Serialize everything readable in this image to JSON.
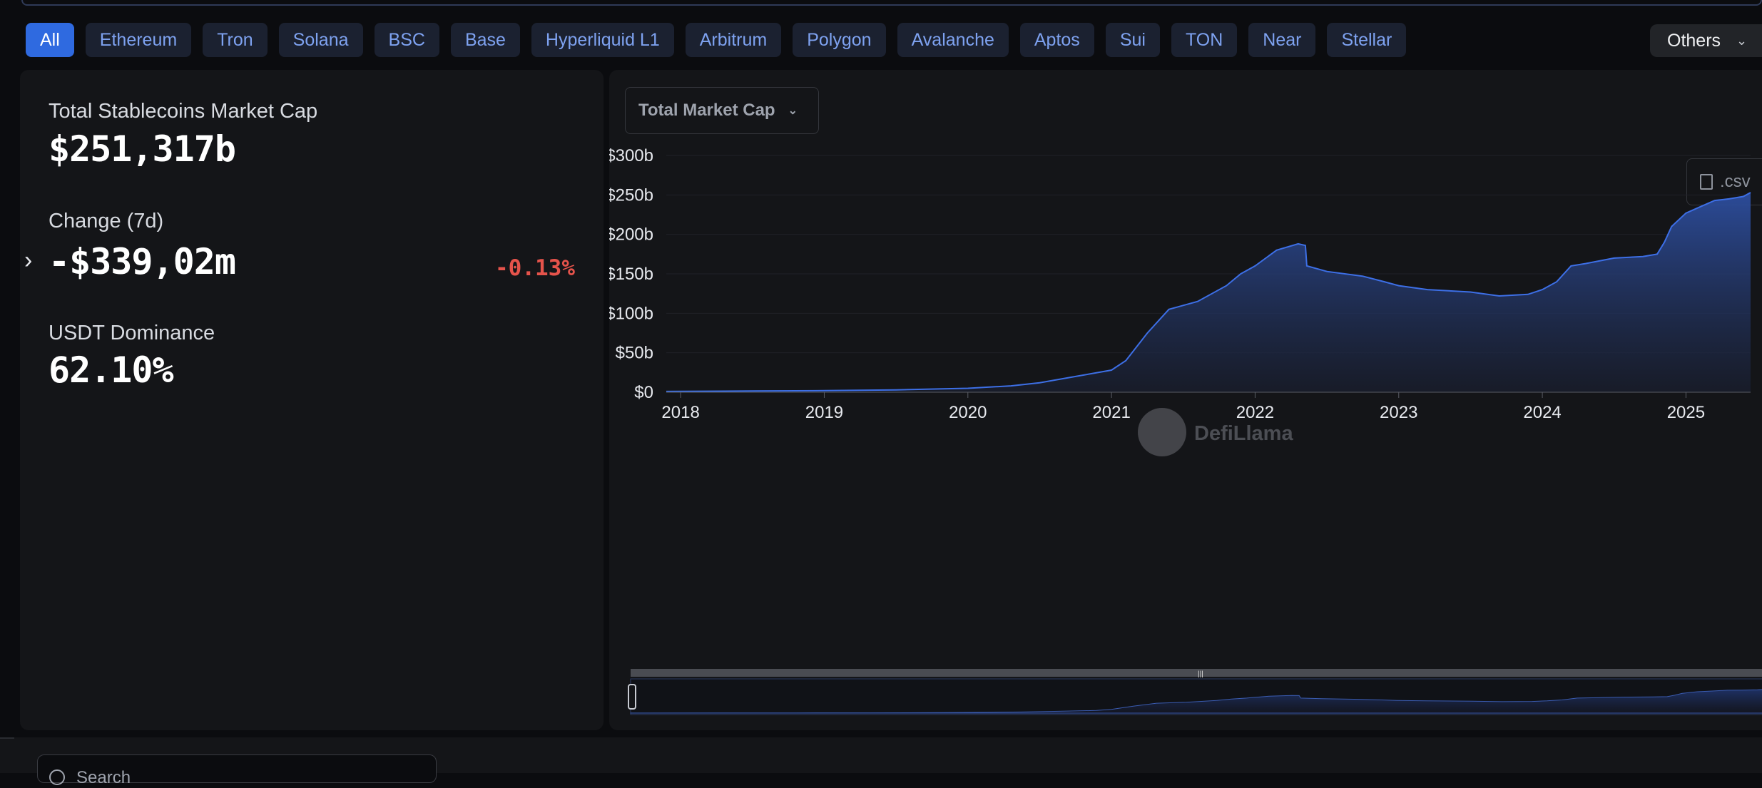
{
  "tabs": [
    {
      "label": "All",
      "active": true
    },
    {
      "label": "Ethereum"
    },
    {
      "label": "Tron"
    },
    {
      "label": "Solana"
    },
    {
      "label": "BSC"
    },
    {
      "label": "Base"
    },
    {
      "label": "Hyperliquid L1"
    },
    {
      "label": "Arbitrum"
    },
    {
      "label": "Polygon"
    },
    {
      "label": "Avalanche"
    },
    {
      "label": "Aptos"
    },
    {
      "label": "Sui"
    },
    {
      "label": "TON"
    },
    {
      "label": "Near"
    },
    {
      "label": "Stellar"
    }
  ],
  "others": {
    "label": "Others",
    "icon": "chevron-down-icon"
  },
  "stats": {
    "total_label": "Total Stablecoins Market Cap",
    "total_value": "$251,317b",
    "change_label": "Change (7d)",
    "change_value": "-$339,02m",
    "change_pct": "-0.13%",
    "dominance_label": "USDT Dominance",
    "dominance_value": "62.10%"
  },
  "chart_select": {
    "label": "Total Market Cap",
    "icon": "chevron-down-icon"
  },
  "csv_button": {
    "label": ".csv",
    "icon": "file-download-icon"
  },
  "watermark": {
    "label": "DefiLlama",
    "icon": "llama-logo-icon"
  },
  "search": {
    "placeholder": "Search"
  },
  "colors": {
    "accent": "#2f6ae0",
    "line": "#3d6fe6",
    "negative": "#e5534b"
  },
  "chart_data": {
    "type": "area",
    "title": "",
    "xlabel": "",
    "ylabel": "",
    "y_tick_labels": [
      "$0",
      "$50b",
      "$100b",
      "$150b",
      "$200b",
      "$250b",
      "$300b"
    ],
    "y_tick_values": [
      0,
      50,
      100,
      150,
      200,
      250,
      300
    ],
    "x_tick_labels": [
      "2018",
      "2019",
      "2020",
      "2021",
      "2022",
      "2023",
      "2024",
      "2025"
    ],
    "x_tick_values": [
      2018,
      2019,
      2020,
      2021,
      2022,
      2023,
      2024,
      2025
    ],
    "xlim": [
      2017.9,
      2025.45
    ],
    "ylim": [
      0,
      300
    ],
    "grid": true,
    "series": [
      {
        "values_unit": "billions USD",
        "x": [
          2017.9,
          2018.5,
          2019.0,
          2019.5,
          2020.0,
          2020.3,
          2020.5,
          2020.75,
          2021.0,
          2021.1,
          2021.25,
          2021.4,
          2021.6,
          2021.8,
          2021.9,
          2022.0,
          2022.15,
          2022.3,
          2022.35,
          2022.36,
          2022.5,
          2022.75,
          2022.9,
          2023.0,
          2023.2,
          2023.5,
          2023.7,
          2023.9,
          2024.0,
          2024.1,
          2024.2,
          2024.3,
          2024.5,
          2024.7,
          2024.8,
          2024.85,
          2024.9,
          2025.0,
          2025.1,
          2025.2,
          2025.3,
          2025.4,
          2025.45
        ],
        "y": [
          1,
          1.5,
          2,
          3,
          5,
          8,
          12,
          20,
          28,
          40,
          75,
          105,
          115,
          135,
          150,
          160,
          180,
          188,
          186,
          160,
          153,
          147,
          140,
          135,
          130,
          127,
          122,
          124,
          130,
          140,
          160,
          163,
          170,
          172,
          175,
          190,
          210,
          227,
          235,
          243,
          245,
          248,
          253
        ]
      }
    ]
  }
}
